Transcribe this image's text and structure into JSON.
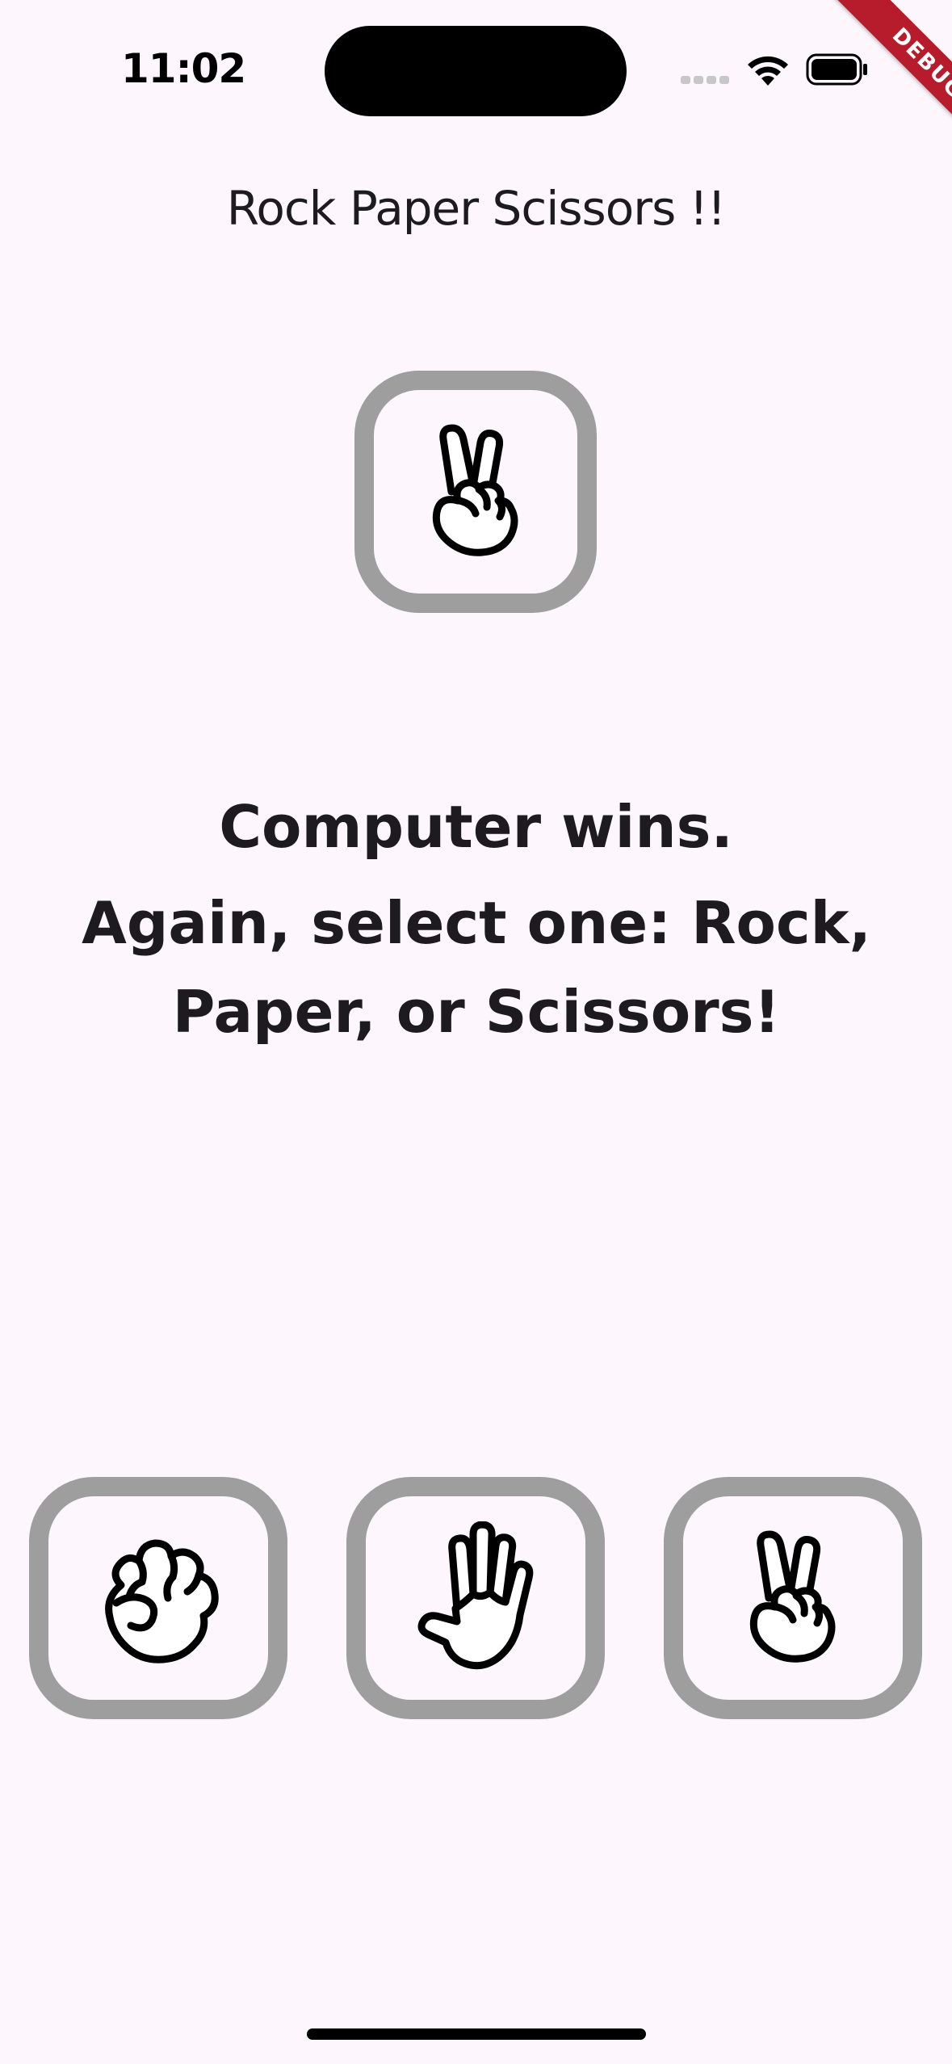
{
  "status_bar": {
    "time": "11:02",
    "icons": [
      "signal-dots-icon",
      "wifi-icon",
      "battery-icon"
    ]
  },
  "debug_banner": "DEBUG",
  "app_bar": {
    "title": "Rock Paper Scissors !!"
  },
  "computer_choice": {
    "icon": "scissors-hand-icon"
  },
  "message": {
    "result": "Computer wins.",
    "prompt": "Again, select one: Rock, Paper, or Scissors!"
  },
  "choices": [
    {
      "name": "Rock",
      "icon": "rock-hand-icon"
    },
    {
      "name": "Paper",
      "icon": "paper-hand-icon"
    },
    {
      "name": "Scissors",
      "icon": "scissors-hand-icon"
    }
  ],
  "colors": {
    "background": "#fdf7fd",
    "box_border": "#9e9e9e",
    "text": "#1d1b20",
    "debug_banner": "#b71c2c"
  }
}
